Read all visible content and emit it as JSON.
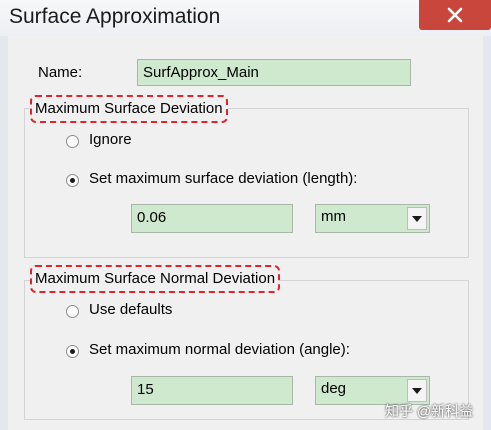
{
  "window": {
    "title": "Surface Approximation",
    "close_icon": "close-icon"
  },
  "name_field": {
    "label": "Name:",
    "value": "SurfApprox_Main"
  },
  "surface_deviation": {
    "legend": "Maximum Surface Deviation",
    "options": [
      {
        "label": "Ignore",
        "checked": false
      },
      {
        "label": "Set maximum surface deviation (length):",
        "checked": true
      }
    ],
    "value": "0.06",
    "unit": "mm"
  },
  "normal_deviation": {
    "legend": "Maximum Surface Normal Deviation",
    "options": [
      {
        "label": "Use defaults",
        "checked": false
      },
      {
        "label": "Set maximum normal deviation (angle):",
        "checked": true
      }
    ],
    "value": "15",
    "unit": "deg"
  },
  "watermark": "知乎 @新科益",
  "colors": {
    "highlight": "#e0242a",
    "field_bg": "#cfe9cf",
    "close_bg": "#c9463d"
  }
}
